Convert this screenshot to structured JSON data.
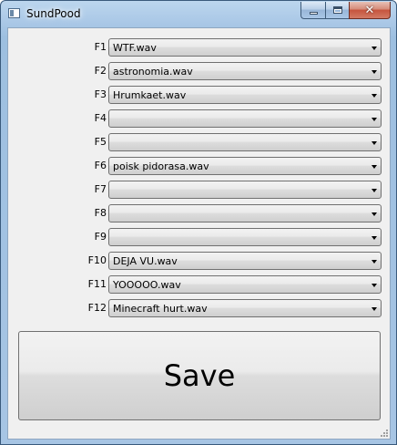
{
  "window": {
    "title": "SundPood",
    "icons": {
      "app": "window-icon",
      "minimize": "minimize-icon",
      "maximize": "maximize-icon",
      "close": "close-icon"
    },
    "close_glyph": "✕"
  },
  "rows": [
    {
      "key": "F1",
      "value": "WTF.wav"
    },
    {
      "key": "F2",
      "value": "astronomia.wav"
    },
    {
      "key": "F3",
      "value": "Hrumkaet.wav"
    },
    {
      "key": "F4",
      "value": ""
    },
    {
      "key": "F5",
      "value": ""
    },
    {
      "key": "F6",
      "value": "poisk pidorasa.wav"
    },
    {
      "key": "F7",
      "value": ""
    },
    {
      "key": "F8",
      "value": ""
    },
    {
      "key": "F9",
      "value": ""
    },
    {
      "key": "F10",
      "value": "DEJA VU.wav"
    },
    {
      "key": "F11",
      "value": "YOOOOO.wav"
    },
    {
      "key": "F12",
      "value": "Minecraft hurt.wav"
    }
  ],
  "save_label": "Save"
}
